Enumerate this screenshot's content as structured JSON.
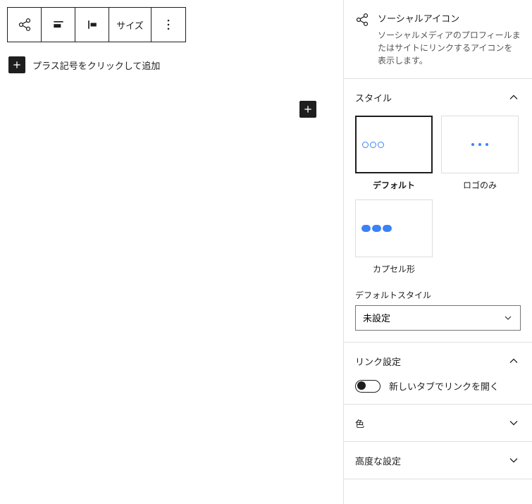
{
  "toolbar": {
    "size_label": "サイズ"
  },
  "editor": {
    "add_prompt": "プラス記号をクリックして追加"
  },
  "block": {
    "title": "ソーシャルアイコン",
    "description": "ソーシャルメディアのプロフィールまたはサイトにリンクするアイコンを表示します。"
  },
  "panels": {
    "style": {
      "title": "スタイル",
      "options": {
        "default": "デフォルト",
        "logo_only": "ロゴのみ",
        "pill": "カプセル形"
      },
      "default_style_label": "デフォルトスタイル",
      "default_style_value": "未設定"
    },
    "link": {
      "title": "リンク設定",
      "new_tab_label": "新しいタブでリンクを開く"
    },
    "color": {
      "title": "色"
    },
    "advanced": {
      "title": "高度な設定"
    }
  }
}
